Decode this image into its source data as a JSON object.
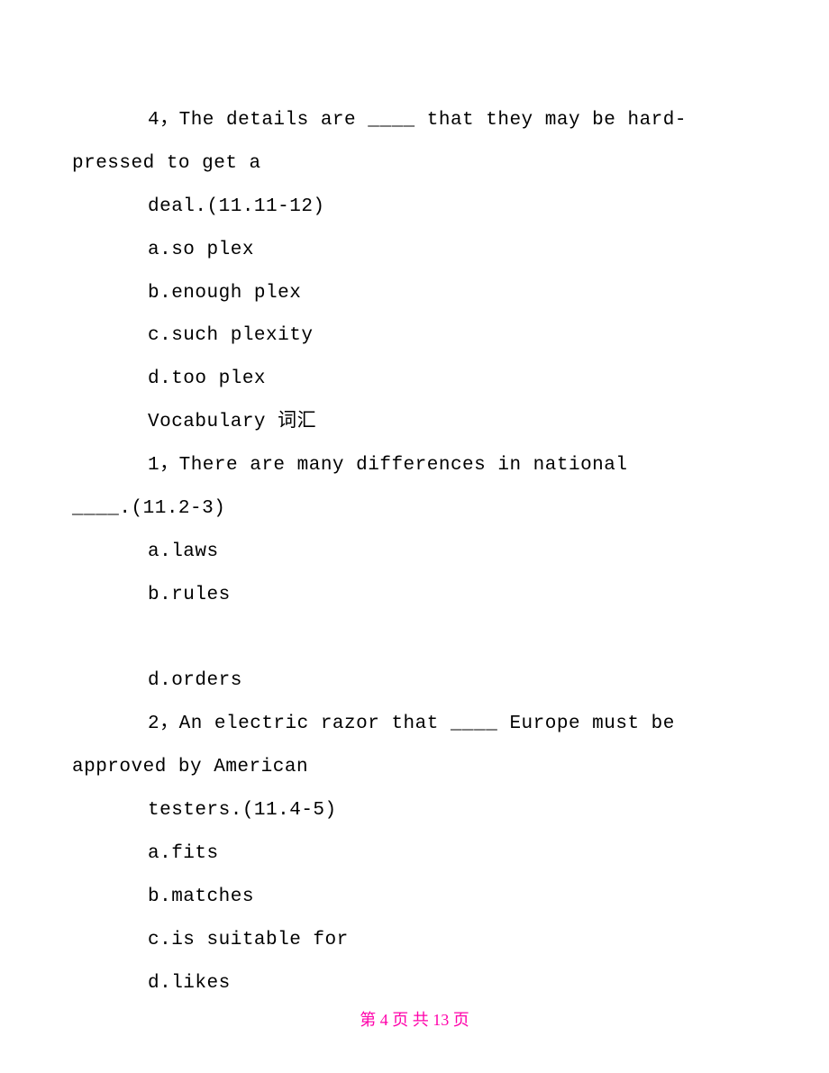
{
  "blocks": [
    {
      "lines": [
        {
          "cls": "ind1 mono",
          "text": "4，The details are ____ that they may be hard-"
        },
        {
          "cls": "hang mono",
          "text": "pressed to get a"
        },
        {
          "cls": "ind1 mono",
          "text": "deal.(11.11-12)"
        },
        {
          "cls": "ind1 mono",
          "text": "a.so plex"
        },
        {
          "cls": "ind1 mono",
          "text": "b.enough plex"
        },
        {
          "cls": "ind1 mono",
          "text": "c.such plexity"
        },
        {
          "cls": "ind1 mono",
          "text": "d.too plex"
        }
      ]
    },
    {
      "lines": [
        {
          "cls": "ind1 mono",
          "text": "Vocabulary 词汇"
        }
      ]
    },
    {
      "lines": [
        {
          "cls": "ind1 mono",
          "text": "1，There are many differences in national "
        },
        {
          "cls": "hang mono",
          "text": "____.(11.2-3)"
        },
        {
          "cls": "ind1 mono",
          "text": "a.laws"
        },
        {
          "cls": "ind1 mono",
          "text": "b.rules"
        },
        {
          "cls": "ind1 mono",
          "text": " "
        },
        {
          "cls": "ind1 mono",
          "text": "d.orders"
        }
      ]
    },
    {
      "lines": [
        {
          "cls": "ind1 mono",
          "text": "2，An electric razor that ____ Europe must be "
        },
        {
          "cls": "hang mono",
          "text": "approved by American"
        },
        {
          "cls": "ind1 mono",
          "text": "testers.(11.4-5)"
        },
        {
          "cls": "ind1 mono",
          "text": "a.fits"
        },
        {
          "cls": "ind1 mono",
          "text": "b.matches"
        },
        {
          "cls": "ind1 mono",
          "text": "c.is suitable for"
        },
        {
          "cls": "ind1 mono",
          "text": "d.likes"
        }
      ]
    }
  ],
  "footer": "第 4 页 共 13 页"
}
